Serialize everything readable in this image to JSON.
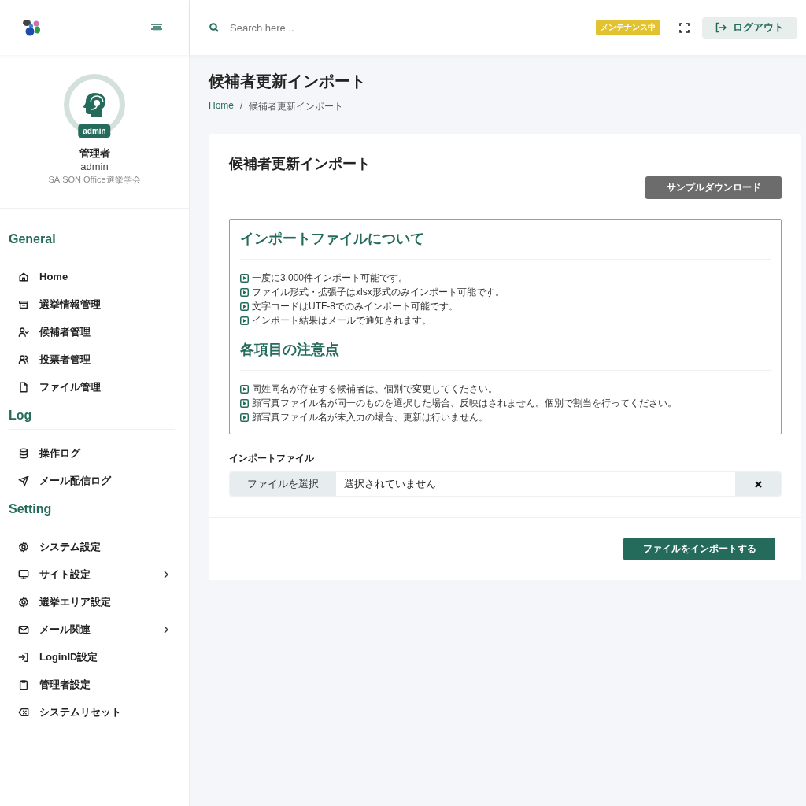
{
  "sidebar": {
    "profile": {
      "badge": "admin",
      "role": "管理者",
      "username": "admin",
      "organization": "SAISON Office選挙学会"
    },
    "sections": [
      {
        "title": "General",
        "items": [
          {
            "label": "Home",
            "has_submenu": false
          },
          {
            "label": "選挙情報管理",
            "has_submenu": false
          },
          {
            "label": "候補者管理",
            "has_submenu": false
          },
          {
            "label": "投票者管理",
            "has_submenu": false
          },
          {
            "label": "ファイル管理",
            "has_submenu": false
          }
        ]
      },
      {
        "title": "Log",
        "items": [
          {
            "label": "操作ログ",
            "has_submenu": false
          },
          {
            "label": "メール配信ログ",
            "has_submenu": false
          }
        ]
      },
      {
        "title": "Setting",
        "items": [
          {
            "label": "システム設定",
            "has_submenu": false
          },
          {
            "label": "サイト設定",
            "has_submenu": true
          },
          {
            "label": "選挙エリア設定",
            "has_submenu": false
          },
          {
            "label": "メール関連",
            "has_submenu": true
          },
          {
            "label": "LoginID設定",
            "has_submenu": false
          },
          {
            "label": "管理者設定",
            "has_submenu": false
          },
          {
            "label": "システムリセット",
            "has_submenu": false
          }
        ]
      }
    ]
  },
  "header": {
    "search": {
      "placeholder": "Search here .."
    },
    "maintenance_badge": "メンテナンス中",
    "logout_button": "ログアウト"
  },
  "page": {
    "title": "候補者更新インポート",
    "breadcrumb": [
      "Home",
      "候補者更新インポート"
    ],
    "breadcrumb_separator": "/"
  },
  "card": {
    "title": "候補者更新インポート",
    "sample_button": "サンプルダウンロード",
    "info_sections": [
      {
        "heading": "インポートファイルについて",
        "items": [
          "一度に3,000件インポート可能です。",
          "ファイル形式・拡張子はxlsx形式のみインポート可能です。",
          "文字コードはUTF-8でのみインポート可能です。",
          "インポート結果はメールで通知されます。"
        ]
      },
      {
        "heading": "各項目の注意点",
        "items": [
          "同姓同名が存在する候補者は、個別で変更してください。",
          "顔写真ファイル名が同一のものを選択した場合、反映はされません。個別で割当を行ってください。",
          "顔写真ファイル名が未入力の場合、更新は行いません。"
        ]
      }
    ],
    "file_label": "インポートファイル",
    "choose_button": "ファイルを選択",
    "file_value": "選択されていません",
    "import_button": "ファイルをインポートする"
  }
}
